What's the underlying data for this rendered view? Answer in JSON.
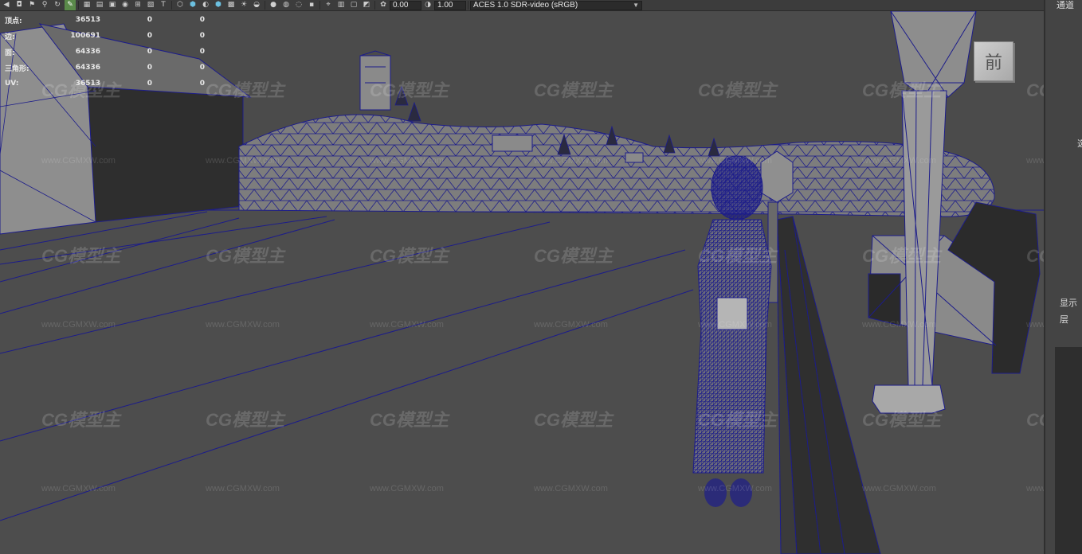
{
  "toolbar": {
    "exposure_value": "0.00",
    "gamma_value": "1.00",
    "color_space": "ACES 1.0 SDR-video (sRGB)"
  },
  "hud": {
    "rows": [
      {
        "label": "顶点:",
        "v1": "36513",
        "v2": "0",
        "v3": "0"
      },
      {
        "label": "边:",
        "v1": "100691",
        "v2": "0",
        "v3": "0"
      },
      {
        "label": "面:",
        "v1": "64336",
        "v2": "0",
        "v3": "0"
      },
      {
        "label": "三角形:",
        "v1": "64336",
        "v2": "0",
        "v3": "0"
      },
      {
        "label": "UV:",
        "v1": "36513",
        "v2": "0",
        "v3": "0"
      }
    ]
  },
  "viewcube": {
    "label": "前"
  },
  "watermark": {
    "logo": "CG模型主",
    "url": "www.CGMXW.com"
  },
  "right_panel": {
    "channel_label": "通道",
    "partial_label": "选",
    "display_label": "显示",
    "layer_label": "层"
  },
  "colors": {
    "wire": "#1c1c8a",
    "viewport_bg": "#4b4b4b",
    "toolbar_bg": "#3c3c3c"
  }
}
